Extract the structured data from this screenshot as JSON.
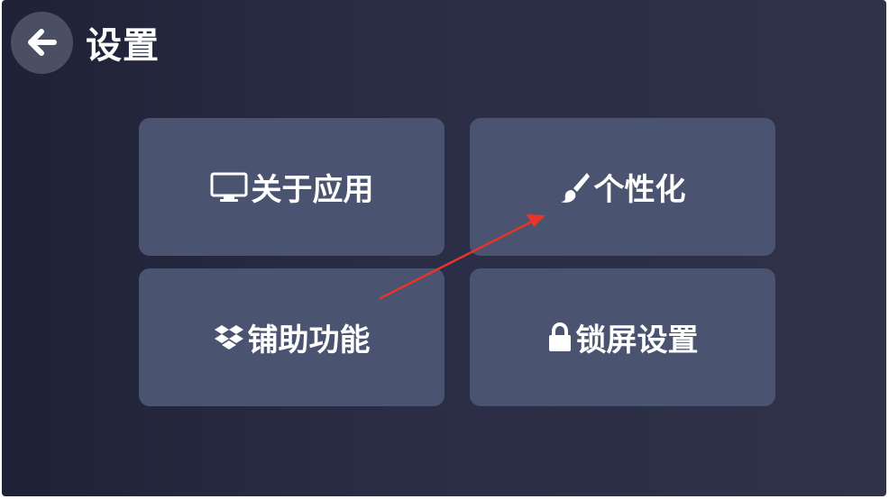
{
  "header": {
    "title": "设置",
    "back_icon": "arrow-left-icon"
  },
  "cards": [
    {
      "label": "关于应用",
      "icon": "monitor-icon"
    },
    {
      "label": "个性化",
      "icon": "paintbrush-icon"
    },
    {
      "label": "铺助功能",
      "icon": "dropbox-icon"
    },
    {
      "label": "锁屏设置",
      "icon": "lock-icon"
    }
  ],
  "annotation": {
    "type": "red-arrow",
    "color": "#e8352a",
    "points_to": "个性化"
  },
  "colors": {
    "background": "#2a2d45",
    "card": "#4a5470",
    "back_button": "#4a4f64",
    "text": "#ffffff"
  }
}
